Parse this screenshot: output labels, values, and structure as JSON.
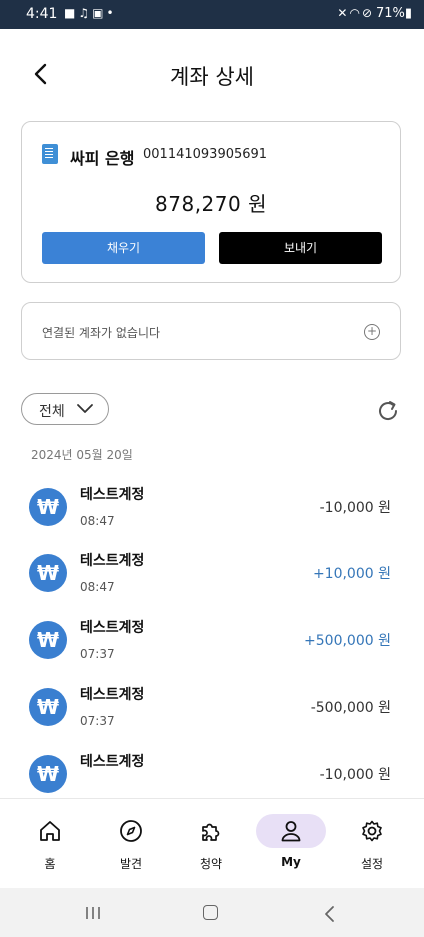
{
  "status_bar": {
    "time": "4:41",
    "left_icons": [
      "video-icon",
      "music-icon",
      "bag-icon",
      "dot-icon"
    ],
    "right_icons": [
      "mute-icon",
      "wifi-icon",
      "no-disturb-icon"
    ],
    "battery": "71%"
  },
  "header": {
    "title": "계좌 상세",
    "back_icon": "chevron-left-icon"
  },
  "account": {
    "bank_name": "싸피 은행",
    "account_number": "001141093905691",
    "balance": "878,270 원",
    "fill_label": "채우기",
    "send_label": "보내기",
    "fill_color": "#3b82d6",
    "send_color": "#000000"
  },
  "linked": {
    "text": "연결된 계좌가 없습니다",
    "add_icon": "plus-circle-icon"
  },
  "filter": {
    "label": "전체",
    "refresh_icon": "refresh-icon"
  },
  "date_label": "2024년 05월 20일",
  "transactions": [
    {
      "name": "테스트계정",
      "time": "08:47",
      "amount": "-10,000 원",
      "direction": "out"
    },
    {
      "name": "테스트계정",
      "time": "08:47",
      "amount": "+10,000 원",
      "direction": "in"
    },
    {
      "name": "테스트계정",
      "time": "07:37",
      "amount": "+500,000 원",
      "direction": "in"
    },
    {
      "name": "테스트계정",
      "time": "07:37",
      "amount": "-500,000 원",
      "direction": "out"
    },
    {
      "name": "테스트계정",
      "time": "",
      "amount": "-10,000 원",
      "direction": "out"
    }
  ],
  "currency_symbol": "₩",
  "nav": {
    "items": [
      {
        "label": "홈",
        "icon": "home-icon"
      },
      {
        "label": "발견",
        "icon": "compass-icon"
      },
      {
        "label": "청약",
        "icon": "puzzle-icon"
      },
      {
        "label": "My",
        "icon": "user-icon",
        "active": true
      },
      {
        "label": "설정",
        "icon": "gear-icon"
      }
    ],
    "active_color": "#e8e0f6"
  },
  "colors": {
    "accent": "#3b82d6",
    "positive_amount": "#3576b8",
    "status_bar": "#1f3046"
  }
}
